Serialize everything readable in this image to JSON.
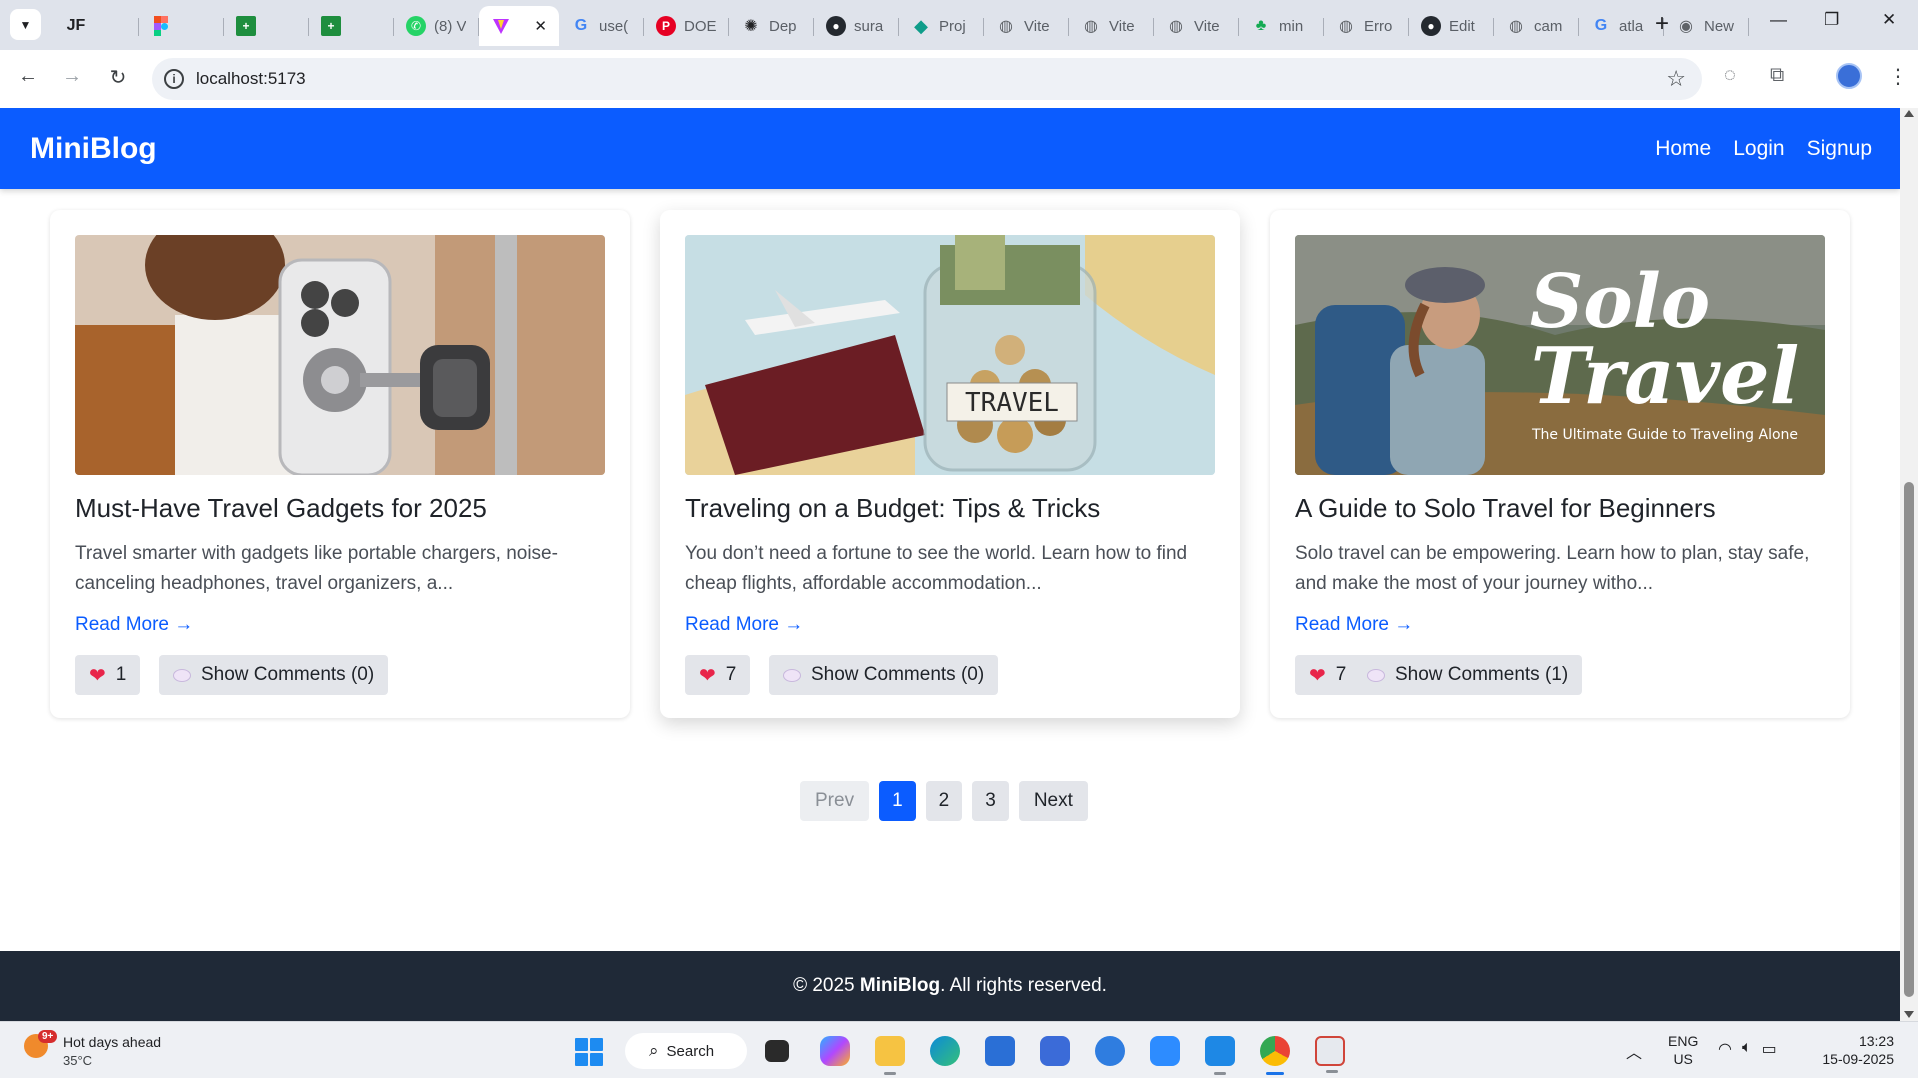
{
  "browser": {
    "tabs": [
      {
        "icon": "jf-icon",
        "label": "JF"
      },
      {
        "icon": "figma-icon",
        "label": ""
      },
      {
        "icon": "sheets-icon",
        "label": ""
      },
      {
        "icon": "sheets-icon",
        "label": ""
      },
      {
        "icon": "whatsapp-icon",
        "label": "(8) V"
      },
      {
        "icon": "vite-icon",
        "label": "",
        "active": true
      },
      {
        "icon": "google-icon",
        "label": "use("
      },
      {
        "icon": "pinterest-icon",
        "label": "DOE"
      },
      {
        "icon": "openai-icon",
        "label": "Dep"
      },
      {
        "icon": "github-icon",
        "label": "sura"
      },
      {
        "icon": "diamond-icon",
        "label": "Proj"
      },
      {
        "icon": "globe-icon",
        "label": "Vite"
      },
      {
        "icon": "globe-icon",
        "label": "Vite"
      },
      {
        "icon": "globe-icon",
        "label": "Vite"
      },
      {
        "icon": "mongo-icon",
        "label": "min"
      },
      {
        "icon": "globe-icon",
        "label": "Erro"
      },
      {
        "icon": "github-icon",
        "label": "Edit"
      },
      {
        "icon": "globe-icon",
        "label": "cam"
      },
      {
        "icon": "google-icon",
        "label": "atla"
      },
      {
        "icon": "chrome-icon",
        "label": "New"
      }
    ],
    "url": "localhost:5173"
  },
  "site": {
    "brand": "MiniBlog",
    "nav": {
      "home": "Home",
      "login": "Login",
      "signup": "Signup"
    },
    "posts": [
      {
        "title": "Must-Have Travel Gadgets for 2025",
        "excerpt": "Travel smarter with gadgets like portable chargers, noise-canceling headphones, travel organizers, a...",
        "read_more": "Read More →",
        "likes": "1",
        "comments_label": "Show Comments (0)"
      },
      {
        "title": "Traveling on a Budget: Tips & Tricks",
        "excerpt": "You don’t need a fortune to see the world. Learn how to find cheap flights, affordable accommodation...",
        "read_more": "Read More →",
        "likes": "7",
        "comments_label": "Show Comments (0)",
        "image_text": "TRAVEL"
      },
      {
        "title": "A Guide to Solo Travel for Beginners",
        "excerpt": "Solo travel can be empowering. Learn how to plan, stay safe, and make the most of your journey witho...",
        "read_more": "Read More →",
        "likes": "7",
        "comments_label": "Show Comments (1)",
        "image_text": "Solo",
        "image_text2": "Travel",
        "image_sub": "The Ultimate Guide to Traveling Alone"
      }
    ],
    "pagination": {
      "prev": "Prev",
      "pages": [
        "1",
        "2",
        "3"
      ],
      "current": "1",
      "next": "Next"
    },
    "footer": {
      "prefix": "© 2025 ",
      "brand": "MiniBlog",
      "suffix": ". All rights reserved."
    }
  },
  "taskbar": {
    "weather": {
      "badge": "9+",
      "title": "Hot days ahead",
      "temp": "35°C"
    },
    "search_label": "Search",
    "lang": {
      "line1": "ENG",
      "line2": "US"
    },
    "time": "13:23",
    "date": "15-09-2025"
  },
  "colors": {
    "accent": "#0b5cff",
    "footer": "#1f2937",
    "heart": "#e8254a"
  }
}
